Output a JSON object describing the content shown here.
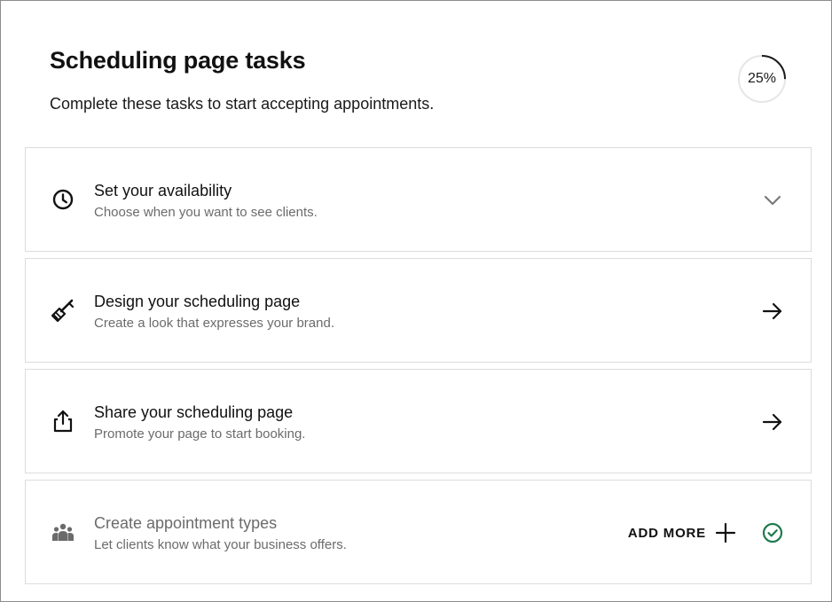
{
  "header": {
    "title": "Scheduling page tasks",
    "subtitle": "Complete these tasks to start accepting appointments.",
    "progress_label": "25%",
    "progress_fraction": 0.25
  },
  "tasks": [
    {
      "title": "Set your availability",
      "description": "Choose when you want to see clients.",
      "icon": "clock-icon",
      "action_icon": "chevron-down-icon",
      "completed": false
    },
    {
      "title": "Design your scheduling page",
      "description": "Create a look that expresses your brand.",
      "icon": "paintbrush-icon",
      "action_icon": "arrow-right-icon",
      "completed": false
    },
    {
      "title": "Share your scheduling page",
      "description": "Promote your page to start booking.",
      "icon": "share-icon",
      "action_icon": "arrow-right-icon",
      "completed": false
    },
    {
      "title": "Create appointment types",
      "description": "Let clients know what your business offers.",
      "icon": "people-group-icon",
      "action_icon": "check-circle-icon",
      "completed": true,
      "add_more_label": "ADD MORE"
    }
  ],
  "colors": {
    "text_primary": "#111111",
    "text_secondary": "#6b6b6b",
    "border": "#dcdcdc",
    "progress_track": "#e6e6e6",
    "progress_fill": "#1a1a1a",
    "success": "#1f7a4d"
  }
}
